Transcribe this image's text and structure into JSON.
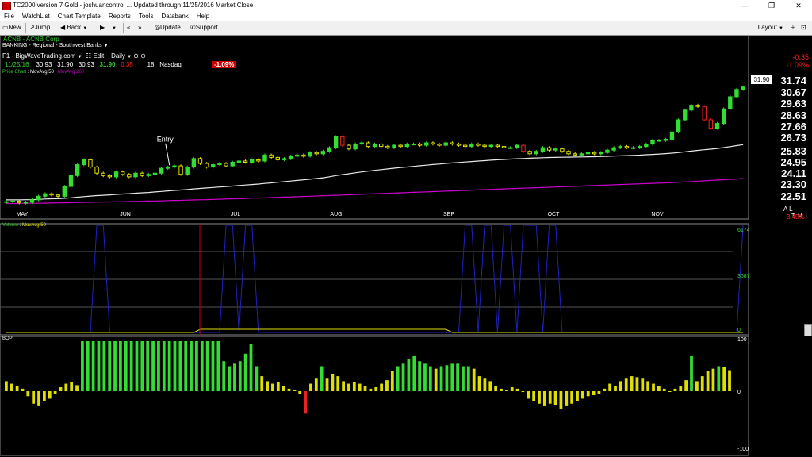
{
  "window": {
    "title": "TC2000 version 7 Gold - joshuancontrol   ... Updated through 11/25/2016  Market Close",
    "buttons": [
      "—",
      "❐",
      "✕"
    ]
  },
  "menu": [
    "File",
    "WatchList",
    "Chart Template",
    "Reports",
    "Tools",
    "Databank",
    "Help"
  ],
  "toolbar": {
    "new": "New",
    "jump": "Jump",
    "back": "Back",
    "update": "Update",
    "support": "Support",
    "layout": "Layout"
  },
  "chart_header": {
    "symbol_line": "ACNB - ACNB Corp",
    "industry": "BANKING - Regional - Southwest Banks",
    "template": "F1 - BigWaveTrading.com",
    "edit": "Edit",
    "period": "Daily",
    "date": "11/25/16",
    "open": "30.93",
    "high": "31.90",
    "low": "30.93",
    "close": "31.90",
    "change": "0.35",
    "count": "18",
    "exchange": "Nasdaq",
    "pct_change": "-1.09%",
    "right_change": "-0.35",
    "right_pct": "-1.09%",
    "last_price": "31.90",
    "al_label": "A L",
    "tml_label": "T M L",
    "bottom_pct": "3.49%"
  },
  "legends": {
    "price": "Price Chart",
    "ma50": "MovAvg 50",
    "ma200": "MovAvg 200",
    "volume": "Volume",
    "vol_ma": "MovAvg 50",
    "bop": "BOP"
  },
  "colors": {
    "up": "#33dd33",
    "down_close": "#e0e000",
    "down_red": "#ee2222",
    "ma50": "#e8e8e8",
    "ma200": "#cc00cc",
    "volume": "#2020c0",
    "bop_up": "#33dd33",
    "bop_neutral": "#e0e000",
    "bop_down": "#ee2222",
    "grid": "#555555"
  },
  "chart_data": {
    "type": "candlestick",
    "x_months": [
      "MAY",
      "JUN",
      "JUL",
      "AUG",
      "SEP",
      "OCT",
      "NOV"
    ],
    "y_ticks": [
      "31.74",
      "30.67",
      "29.63",
      "28.63",
      "27.66",
      "26.73",
      "25.83",
      "24.95",
      "24.11",
      "23.30",
      "22.51"
    ],
    "ylim": [
      22.2,
      32.6
    ],
    "close": [
      22.45,
      22.5,
      22.35,
      22.4,
      22.6,
      22.9,
      23.1,
      23.0,
      22.9,
      23.7,
      24.6,
      25.5,
      25.9,
      25.3,
      24.8,
      24.6,
      24.5,
      24.9,
      24.7,
      24.5,
      24.8,
      24.6,
      24.7,
      24.8,
      25.2,
      25.3,
      25.4,
      24.7,
      25.3,
      26.0,
      25.6,
      25.3,
      25.5,
      25.6,
      25.4,
      25.7,
      25.8,
      25.7,
      25.9,
      25.8,
      26.3,
      26.1,
      25.9,
      26.0,
      26.2,
      26.3,
      26.2,
      26.5,
      26.4,
      26.6,
      26.9,
      27.8,
      27.1,
      26.8,
      27.2,
      27.3,
      27.0,
      27.2,
      27.0,
      26.9,
      27.1,
      27.0,
      27.2,
      27.2,
      27.1,
      27.3,
      27.2,
      27.1,
      27.3,
      27.2,
      27.1,
      27.0,
      27.2,
      27.1,
      27.0,
      27.1,
      27.0,
      26.9,
      26.9,
      27.1,
      26.6,
      26.4,
      26.6,
      26.9,
      26.7,
      26.8,
      26.6,
      26.4,
      26.3,
      26.4,
      26.5,
      26.4,
      26.5,
      26.7,
      26.9,
      27.0,
      26.9,
      26.9,
      27.0,
      27.2,
      27.5,
      27.5,
      27.6,
      28.2,
      29.2,
      30.0,
      30.4,
      30.3,
      29.2,
      28.5,
      28.9,
      30.1,
      31.1,
      31.7,
      31.9
    ],
    "ma50": [
      22.6,
      22.6,
      22.6,
      22.61,
      22.62,
      22.64,
      22.67,
      22.69,
      22.7,
      22.73,
      22.77,
      22.82,
      22.87,
      22.91,
      22.95,
      22.98,
      23.01,
      23.05,
      23.08,
      23.11,
      23.15,
      23.18,
      23.21,
      23.25,
      23.29,
      23.34,
      23.38,
      23.41,
      23.45,
      23.5,
      23.54,
      23.58,
      23.62,
      23.66,
      23.7,
      23.74,
      23.78,
      23.82,
      23.86,
      23.9,
      23.95,
      24.0,
      24.05,
      24.1,
      24.15,
      24.2,
      24.25,
      24.3,
      24.36,
      24.42,
      24.5,
      24.6,
      24.68,
      24.75,
      24.83,
      24.9,
      24.97,
      25.03,
      25.09,
      25.15,
      25.21,
      25.26,
      25.31,
      25.36,
      25.41,
      25.46,
      25.51,
      25.55,
      25.6,
      25.64,
      25.68,
      25.72,
      25.76,
      25.8,
      25.83,
      25.87,
      25.9,
      25.93,
      25.96,
      25.99,
      26.01,
      26.03,
      26.05,
      26.07,
      26.09,
      26.1,
      26.11,
      26.12,
      26.13,
      26.14,
      26.15,
      26.16,
      26.17,
      26.19,
      26.21,
      26.23,
      26.25,
      26.27,
      26.29,
      26.32,
      26.35,
      26.38,
      26.41,
      26.45,
      26.5,
      26.56,
      26.62,
      26.68,
      26.73,
      26.78,
      26.84,
      26.91,
      26.99,
      27.07,
      27.15
    ],
    "ma200": [
      22.3,
      22.3,
      22.31,
      22.31,
      22.32,
      22.32,
      22.33,
      22.34,
      22.35,
      22.36,
      22.37,
      22.38,
      22.39,
      22.4,
      22.41,
      22.42,
      22.43,
      22.44,
      22.45,
      22.46,
      22.47,
      22.48,
      22.5,
      22.51,
      22.52,
      22.54,
      22.55,
      22.56,
      22.58,
      22.59,
      22.61,
      22.62,
      22.64,
      22.65,
      22.67,
      22.69,
      22.7,
      22.72,
      22.74,
      22.75,
      22.77,
      22.79,
      22.81,
      22.83,
      22.84,
      22.86,
      22.88,
      22.9,
      22.92,
      22.94,
      22.96,
      22.98,
      23.0,
      23.02,
      23.04,
      23.06,
      23.08,
      23.1,
      23.12,
      23.14,
      23.16,
      23.18,
      23.2,
      23.22,
      23.24,
      23.26,
      23.28,
      23.3,
      23.32,
      23.34,
      23.36,
      23.38,
      23.4,
      23.42,
      23.44,
      23.46,
      23.48,
      23.5,
      23.52,
      23.54,
      23.56,
      23.58,
      23.6,
      23.62,
      23.64,
      23.66,
      23.68,
      23.7,
      23.72,
      23.74,
      23.76,
      23.78,
      23.8,
      23.82,
      23.84,
      23.86,
      23.88,
      23.9,
      23.92,
      23.94,
      23.96,
      23.98,
      24.0,
      24.02,
      24.05,
      24.08,
      24.11,
      24.14,
      24.17,
      24.2,
      24.23,
      24.26,
      24.29,
      24.32,
      24.36
    ],
    "volume_ticks": [
      "6174",
      "3087",
      "0"
    ],
    "volume_peaks": [
      14,
      15,
      34,
      35,
      37,
      38,
      71,
      72,
      74,
      75,
      77,
      78,
      80,
      81,
      82,
      84,
      85,
      114,
      138,
      139,
      140,
      141
    ],
    "bop_ticks": [
      "100",
      "0",
      "-100"
    ],
    "bop": [
      20,
      15,
      10,
      5,
      -10,
      -25,
      -30,
      -20,
      -15,
      -5,
      8,
      15,
      18,
      12,
      100,
      100,
      100,
      100,
      100,
      100,
      100,
      100,
      100,
      100,
      100,
      100,
      100,
      100,
      100,
      100,
      100,
      100,
      100,
      100,
      100,
      100,
      100,
      100,
      100,
      100,
      60,
      50,
      55,
      60,
      75,
      95,
      50,
      30,
      20,
      15,
      18,
      10,
      5,
      2,
      -5,
      -45,
      15,
      25,
      50,
      25,
      35,
      30,
      20,
      15,
      18,
      15,
      10,
      5,
      8,
      15,
      22,
      40,
      50,
      55,
      65,
      70,
      60,
      55,
      50,
      45,
      50,
      52,
      55,
      55,
      50,
      50,
      45,
      30,
      25,
      20,
      10,
      5,
      3,
      8,
      5,
      0,
      -15,
      -20,
      -25,
      -30,
      -25,
      -28,
      -35,
      -30,
      -25,
      -20,
      -15,
      -10,
      -8,
      -5,
      5,
      15,
      10,
      20,
      25,
      30,
      28,
      25,
      20,
      15,
      10,
      5,
      0,
      5,
      10,
      22,
      70,
      20,
      30,
      40,
      45,
      50,
      48,
      42
    ],
    "annotation": "Entry"
  }
}
